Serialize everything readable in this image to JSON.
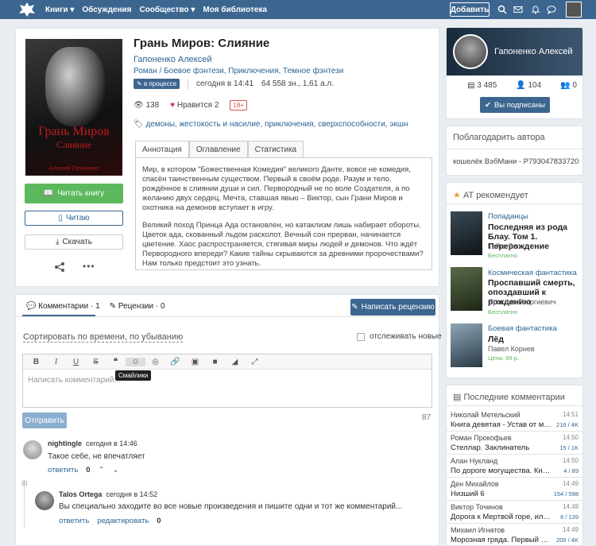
{
  "nav": {
    "books": "Книги",
    "discussions": "Обсуждения",
    "community": "Сообщество",
    "library": "Моя библиотека",
    "add": "Добавить"
  },
  "book": {
    "title": "Грань Миров: Слияние",
    "author": "Гапоненко Алексей",
    "genres": "Роман / Боевое фэнтези, Приключения, Темное фэнтези",
    "status": "в процессе",
    "updated": "сегодня в 14:41",
    "size": "64 558 зн., 1,61 а.л.",
    "views": "138",
    "likes_label": "Нравится",
    "likes": "2",
    "age": "18+",
    "tags": "демоны, жестокость и насилие, приключения, сверхспособности, экшн",
    "cover_title": "Грань Миров",
    "cover_subtitle": "Слияние",
    "cover_author": "Алексей Гапоненко"
  },
  "buttons": {
    "read": "Читать книгу",
    "reading": "Читаю",
    "download": "Скачать"
  },
  "tabs": [
    "Аннотация",
    "Оглавление",
    "Статистика"
  ],
  "annotation": [
    "Мир, в котором \"Божественная Комедия\" великого Данте, вовсе не комедия, спасён таинственным существом. Первый в своём роде. Разум и тело, рождённое в слиянии души и сил. Первородный не по воле Создателя, а по желанию двух сердец. Мечта, ставшая явью – Виктор, сын Грани Миров и охотника на демонов вступает в игру.",
    "Великий поход Принца Ада остановлен, но катаклизм лишь набирает обороты. Цветок ада, скованный льдом расколот. Вечный сон прерван, начинается цветение. Хаос распространяется, стягивая миры людей и демонов. Что ждёт Первородного впереди? Какие тайны скрываются за древними пророчествами? Нам только предстоит это узнать."
  ],
  "comments_section": {
    "comments_tab": "Комментарии",
    "comments_count": "1",
    "reviews_tab": "Рецензии",
    "reviews_count": "0",
    "write_review": "Написать рецензию",
    "sort": "Сортировать по времени, по убыванию",
    "track": "отслеживать новые",
    "placeholder": "Написать комментарий...",
    "tooltip": "Смайлики",
    "send": "Отправить",
    "char_count": "87"
  },
  "comments": [
    {
      "user": "nightingle",
      "time": "сегодня в 14:46",
      "text": "Такое себе, не впечатляет",
      "reply": "ответить",
      "score": "0"
    },
    {
      "user": "Talos Ortega",
      "time": "сегодня в 14:52",
      "text": "Вы специально заходите во все новые произведения и пишите одни и тот же комментарий...",
      "reply": "ответить",
      "edit": "редактировать",
      "score": "0"
    }
  ],
  "profile": {
    "name": "Гапоненко Алексей",
    "books": "3 485",
    "followers": "104",
    "following": "0",
    "subscribed": "Вы подписаны"
  },
  "thank": {
    "title": "Поблагодарить автора",
    "wallet": "кошелёк ВэбМани - P793047833720"
  },
  "recommend": {
    "title": "АТ рекомендует",
    "items": [
      {
        "genre": "Попаданцы",
        "title": "Последняя из рода Блау. Том 1. Перерождение",
        "author": "Тайга Ри",
        "price": "Бесплатно"
      },
      {
        "genre": "Космическая фантастика",
        "title": "Проспавший смерть, опоздавший к рождению",
        "author": "Ярослав Георгиевич",
        "price": "Бесплатно"
      },
      {
        "genre": "Боевая фантастика",
        "title": "Лёд",
        "author": "Павел Корнев",
        "price": "Цена: 99 р."
      }
    ]
  },
  "latest": {
    "title": "Последние комментарии",
    "items": [
      {
        "name": "Николай Метельский",
        "time": "14:51",
        "book": "Книга девятая - Устав от масок",
        "count": "216 / 4K"
      },
      {
        "name": "Роман Прокофьев",
        "time": "14:50",
        "book": "Стеллар. Заклинатель",
        "count": "15 / 1K"
      },
      {
        "name": "Алан Нукланд",
        "time": "14:50",
        "book": "По дороге могущества. Книга ч...",
        "count": "4 / 89"
      },
      {
        "name": "Ден Михайлов",
        "time": "14:49",
        "book": "Низший 6",
        "count": "154 / 598"
      },
      {
        "name": "Виктор Точинов",
        "time": "14:49",
        "book": "Дорога к Мертвой горе, или Сн...",
        "count": "6 / 139"
      },
      {
        "name": "Михаил Игнатов",
        "time": "14:49",
        "book": "Морозная гряда. Первый поис",
        "count": "200 / 4K"
      }
    ]
  }
}
